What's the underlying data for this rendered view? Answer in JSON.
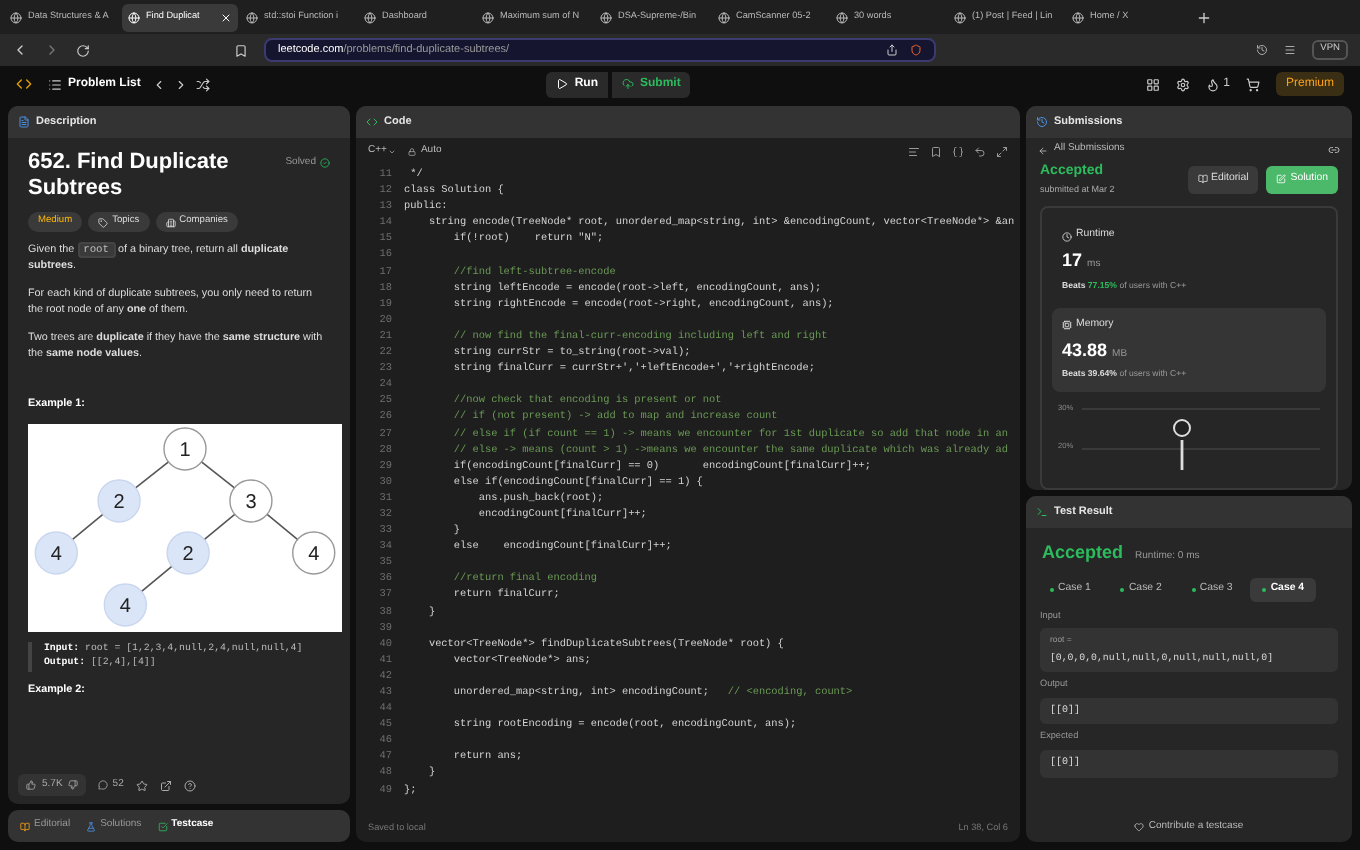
{
  "browser_tabs": [
    {
      "title": "Data Structures & A",
      "selected": false
    },
    {
      "title": "Find Duplicat",
      "selected": true
    },
    {
      "title": "std::stoi Function i",
      "selected": false
    },
    {
      "title": "Dashboard",
      "selected": false
    },
    {
      "title": "Maximum sum of N",
      "selected": false
    },
    {
      "title": "DSA-Supreme-/Bin",
      "selected": false
    },
    {
      "title": "CamScanner 05-2",
      "selected": false
    },
    {
      "title": "30 words",
      "selected": false
    },
    {
      "title": "(1) Post | Feed | Lin",
      "selected": false
    },
    {
      "title": "Home / X",
      "selected": false
    }
  ],
  "address_bar": {
    "host": "leetcode.com",
    "path": "/problems/find-duplicate-subtrees/"
  },
  "vpn_label": "VPN",
  "nav": {
    "problem_list": "Problem List",
    "run": "Run",
    "submit": "Submit",
    "streak": "1",
    "premium": "Premium"
  },
  "description": {
    "tab": "Description",
    "title": "652. Find Duplicate Subtrees",
    "status": "Solved",
    "tags": [
      {
        "label": "Medium",
        "kind": "difficulty"
      },
      {
        "label": "Topics",
        "kind": "topics"
      },
      {
        "label": "Companies",
        "kind": "companies"
      }
    ],
    "paragraphs": [
      [
        {
          "kind": "text",
          "text": "Given the "
        },
        {
          "kind": "code",
          "text": "root"
        },
        {
          "kind": "text",
          "text": " of a binary tree, return all **duplicate subtrees**."
        }
      ],
      [
        {
          "kind": "text",
          "text": "For each kind of duplicate subtrees, you only need to return the root node of any **one** of them."
        }
      ],
      [
        {
          "kind": "text",
          "text": "Two trees are **duplicate** if they have the **same structure** with the **same node values**."
        }
      ]
    ],
    "example_1": {
      "heading": "Example 1:",
      "tree": {
        "value": "1",
        "highlighted": false,
        "children": [
          {
            "value": "2",
            "highlighted": true,
            "children": [
              {
                "value": "4",
                "highlighted": true
              }
            ]
          },
          {
            "value": "3",
            "highlighted": false,
            "children": [
              {
                "value": "2",
                "highlighted": true,
                "children": [
                  {
                    "value": "4",
                    "highlighted": true
                  }
                ]
              },
              {
                "value": "4",
                "highlighted": false
              }
            ]
          }
        ]
      },
      "input_label": "Input:",
      "input": "root = [1,2,3,4,null,2,4,null,null,4]",
      "output_label": "Output:",
      "output": "[[2,4],[4]]"
    },
    "example_2_heading": "Example 2:",
    "likes": "5.7K",
    "comments": "52"
  },
  "bottom_tabs": [
    {
      "label": "Editorial",
      "selected": false,
      "kind": "editorial"
    },
    {
      "label": "Solutions",
      "selected": false,
      "kind": "solutions"
    },
    {
      "label": "Testcase",
      "selected": true,
      "kind": "testcase"
    }
  ],
  "code_panel": {
    "title": "Code",
    "language": "C++",
    "mode": "Auto",
    "status": "Saved to local",
    "cursor": "Ln 38, Col 6",
    "lines": [
      {
        "number": "11",
        "code": " */"
      },
      {
        "number": "12",
        "code": "class Solution {"
      },
      {
        "number": "13",
        "code": "public:"
      },
      {
        "number": "14",
        "code": "    string encode(TreeNode* root, unordered_map<string, int> &encodingCount, vector<TreeNode*> &an"
      },
      {
        "number": "15",
        "code": "        if(!root)    return \"N\";"
      },
      {
        "number": "16"
      },
      {
        "number": "17",
        "comment": "        //find left-subtree-encode"
      },
      {
        "number": "18",
        "code": "        string leftEncode = encode(root->left, encodingCount, ans);"
      },
      {
        "number": "19",
        "code": "        string rightEncode = encode(root->right, encodingCount, ans);"
      },
      {
        "number": "20"
      },
      {
        "number": "21",
        "comment": "        // now find the final-curr-encoding including left and right"
      },
      {
        "number": "22",
        "code": "        string currStr = to_string(root->val);"
      },
      {
        "number": "23",
        "code": "        string finalCurr = currStr+','+leftEncode+','+rightEncode;"
      },
      {
        "number": "24"
      },
      {
        "number": "25",
        "comment": "        //now check that encoding is present or not"
      },
      {
        "number": "26",
        "comment": "        // if (not present) -> add to map and increase count"
      },
      {
        "number": "27",
        "comment": "        // else if (if count == 1) -> means we encounter for 1st duplicate so add that node in an"
      },
      {
        "number": "28",
        "comment": "        // else -> means (count > 1) ->means we encounter the same duplicate which was already ad"
      },
      {
        "number": "29",
        "code": "        if(encodingCount[finalCurr] == 0)       encodingCount[finalCurr]++;"
      },
      {
        "number": "30",
        "code": "        else if(encodingCount[finalCurr] == 1) {"
      },
      {
        "number": "31",
        "code": "            ans.push_back(root);"
      },
      {
        "number": "32",
        "code": "            encodingCount[finalCurr]++;"
      },
      {
        "number": "33",
        "code": "        }"
      },
      {
        "number": "34",
        "code": "        else    encodingCount[finalCurr]++;"
      },
      {
        "number": "35"
      },
      {
        "number": "36",
        "comment": "        //return final encoding"
      },
      {
        "number": "37",
        "code": "        return finalCurr;"
      },
      {
        "number": "38",
        "code": "    }"
      },
      {
        "number": "39"
      },
      {
        "number": "40",
        "code": "    vector<TreeNode*> findDuplicateSubtrees(TreeNode* root) {"
      },
      {
        "number": "41",
        "code": "        vector<TreeNode*> ans;"
      },
      {
        "number": "42"
      },
      {
        "number": "43",
        "code": "        unordered_map<string, int> encodingCount;   ",
        "comment": "// <encoding, count>"
      },
      {
        "number": "44"
      },
      {
        "number": "45",
        "code": "        string rootEncoding = encode(root, encodingCount, ans);"
      },
      {
        "number": "46"
      },
      {
        "number": "47",
        "code": "        return ans;"
      },
      {
        "number": "48",
        "code": "    }"
      },
      {
        "number": "49",
        "code": "};"
      }
    ]
  },
  "submissions": {
    "tab": "Submissions",
    "back": "All Submissions",
    "status": "Accepted",
    "submitted": "submitted at Mar 2",
    "editorial": "Editorial",
    "solution": "Solution",
    "runtime": {
      "label": "Runtime",
      "value": "17",
      "unit": "ms",
      "beats_label": "Beats",
      "beats": "77.15%",
      "suffix": "of users with C++"
    },
    "memory": {
      "label": "Memory",
      "value": "43.88",
      "unit": "MB",
      "beats_label": "Beats",
      "beats": "39.64%",
      "suffix": "of users with C++"
    },
    "chart_axis_labels": [
      "30%",
      "20%"
    ]
  },
  "test_result": {
    "tab": "Test Result",
    "status": "Accepted",
    "runtime": "Runtime: 0 ms",
    "cases": [
      {
        "label": "Case 1",
        "selected": false
      },
      {
        "label": "Case 2",
        "selected": false
      },
      {
        "label": "Case 3",
        "selected": false
      },
      {
        "label": "Case 4",
        "selected": true
      }
    ],
    "input_label": "Input",
    "input_name": "root =",
    "input_value": "[0,0,0,0,null,null,0,null,null,null,0]",
    "output_label": "Output",
    "output": "[[0]]",
    "expected_label": "Expected",
    "expected": "[[0]]",
    "contribute": "Contribute a testcase"
  }
}
